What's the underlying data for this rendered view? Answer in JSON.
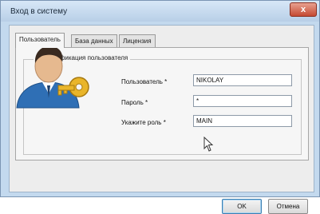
{
  "window": {
    "title": "Вход в систему",
    "close_label": "x"
  },
  "tabs": [
    {
      "label": "Пользователь",
      "active": true
    },
    {
      "label": "База данных",
      "active": false
    },
    {
      "label": "Лицензия",
      "active": false
    }
  ],
  "group": {
    "title": "Аутентификация пользователя"
  },
  "form": {
    "user": {
      "label": "Пользователь *",
      "value": "NIKOLAY"
    },
    "password": {
      "label": "Пароль *",
      "value": "*"
    },
    "role": {
      "label": "Укажите роль *",
      "value": "MAIN"
    }
  },
  "buttons": {
    "ok": "OK",
    "cancel": "Отмена"
  },
  "colors": {
    "titlebar": "#c3d9ee",
    "close": "#c54a32",
    "key": "#e9b52a",
    "avatar_shirt": "#2f6fb5"
  },
  "icons": {
    "avatar": "user-with-key-icon",
    "cursor": "mouse-pointer-icon"
  }
}
